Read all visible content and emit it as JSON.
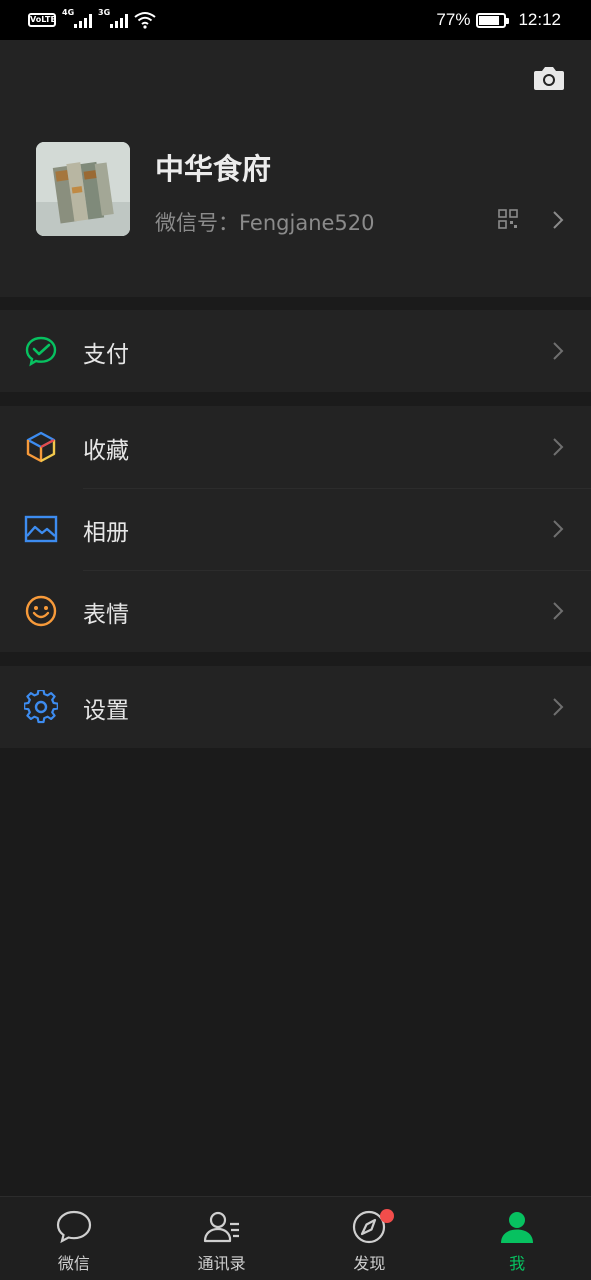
{
  "status_bar": {
    "volte": "VoLTE",
    "sim1_network": "4G",
    "sim2_network": "3G",
    "battery_percent": "77%",
    "battery_level": 0.77,
    "time": "12:12"
  },
  "profile": {
    "nickname": "中华食府",
    "wechat_id": "微信号：Fengjane520",
    "icons": [
      "camera-icon",
      "qr-code-icon",
      "chevron-right-icon"
    ]
  },
  "menu": {
    "pay": {
      "label": "支付",
      "icon": "wechat-pay-icon",
      "color": "#07c160"
    },
    "favorites": {
      "label": "收藏",
      "icon": "cube-icon"
    },
    "album": {
      "label": "相册",
      "icon": "image-icon",
      "color": "#3d8cf0"
    },
    "stickers": {
      "label": "表情",
      "icon": "smiley-icon",
      "color": "#f79a3a"
    },
    "settings": {
      "label": "设置",
      "icon": "gear-icon",
      "color": "#3d8cf0"
    }
  },
  "tabs": [
    {
      "label": "微信",
      "icon": "chat-bubble-icon"
    },
    {
      "label": "通讯录",
      "icon": "contacts-icon"
    },
    {
      "label": "发现",
      "icon": "compass-icon",
      "has_badge": true
    },
    {
      "label": "我",
      "icon": "person-icon",
      "active": true
    }
  ],
  "colors": {
    "accent": "#07c160",
    "badge": "#f24d4b",
    "background": "#1b1b1b",
    "surface": "#232323"
  }
}
